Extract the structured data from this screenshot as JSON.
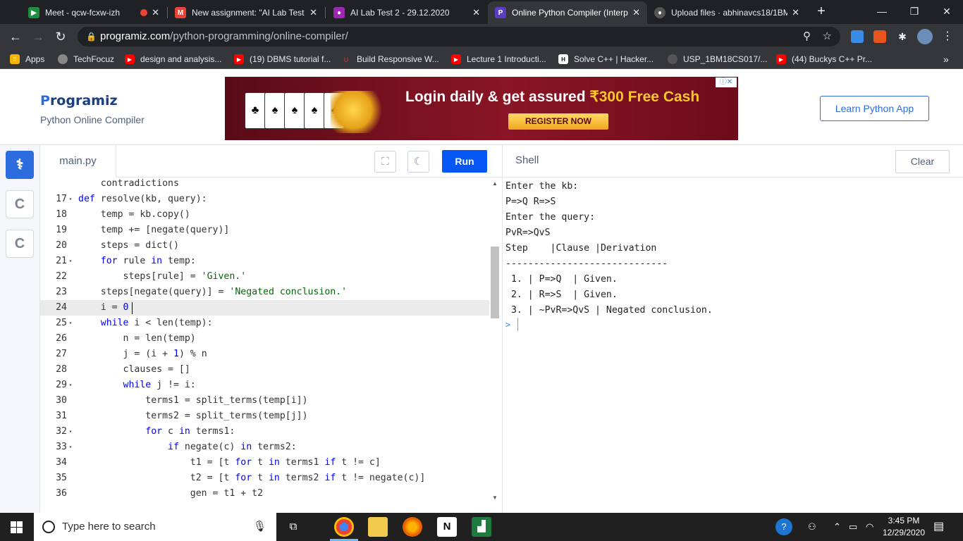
{
  "browser": {
    "tabs": [
      {
        "title": "Meet - qcw-fcxw-izh",
        "icon_color": "#1e8e3e",
        "icon": "video-icon"
      },
      {
        "title": "New assignment: \"AI Lab Test 2",
        "icon_color": "#ea4335",
        "icon": "gmail-icon"
      },
      {
        "title": "AI Lab Test 2 - 29.12.2020",
        "icon_color": "#9c27b0",
        "icon": "classroom-icon"
      },
      {
        "title": "Online Python Compiler (Interp",
        "icon_color": "#5b3cc4",
        "icon": "programiz-icon"
      },
      {
        "title": "Upload files · abhinavcs18/1BM",
        "icon_color": "#555555",
        "icon": "github-icon"
      }
    ],
    "url_host": "programiz.com",
    "url_path": "/python-programming/online-compiler/",
    "bookmarks": [
      {
        "label": "Apps",
        "color": "#f4b400"
      },
      {
        "label": "TechFocuz",
        "color": "#888888"
      },
      {
        "label": "design and analysis...",
        "color": "#ff0000"
      },
      {
        "label": "(19) DBMS tutorial f...",
        "color": "#ff0000"
      },
      {
        "label": "Build Responsive W...",
        "color": "#d32f2f"
      },
      {
        "label": "Lecture 1 Introducti...",
        "color": "#ff0000"
      },
      {
        "label": "Solve C++ | Hacker...",
        "color": "#111111"
      },
      {
        "label": "USP_1BM18CS017/...",
        "color": "#555555"
      },
      {
        "label": "(44) Buckys C++ Pr...",
        "color": "#ff0000"
      }
    ]
  },
  "site": {
    "logo": "rogramiz",
    "logo_p": "P",
    "subtitle": "Python Online Compiler",
    "learn_button": "Learn Python App",
    "ad": {
      "headline_a": "Login daily & get assured ",
      "headline_b": "₹300 Free Cash",
      "cta": "REGISTER NOW"
    }
  },
  "editor": {
    "file_tab": "main.py",
    "run_label": "Run",
    "lines": [
      {
        "n": "",
        "fold": false,
        "html": "    contradictions"
      },
      {
        "n": "17",
        "fold": true,
        "html": "<span class=\"kw\">def</span> resolve(kb, query):"
      },
      {
        "n": "18",
        "fold": false,
        "html": "    temp = kb.copy()"
      },
      {
        "n": "19",
        "fold": false,
        "html": "    temp += [negate(query)]"
      },
      {
        "n": "20",
        "fold": false,
        "html": "    steps = dict()"
      },
      {
        "n": "21",
        "fold": true,
        "html": "    <span class=\"kw\">for</span> rule <span class=\"kw\">in</span> temp:"
      },
      {
        "n": "22",
        "fold": false,
        "html": "        steps[rule] = <span class=\"st\">'Given.'</span>"
      },
      {
        "n": "23",
        "fold": false,
        "html": "    steps[negate(query)] = <span class=\"st\">'Negated conclusion.'</span>"
      },
      {
        "n": "24",
        "fold": false,
        "html": "    i = <span class=\"nm\">0</span>",
        "current": true
      },
      {
        "n": "25",
        "fold": true,
        "html": "    <span class=\"kw\">while</span> i &lt; len(temp):"
      },
      {
        "n": "26",
        "fold": false,
        "html": "        n = len(temp)"
      },
      {
        "n": "27",
        "fold": false,
        "html": "        j = (i + <span class=\"nm\">1</span>) % n"
      },
      {
        "n": "28",
        "fold": false,
        "html": "        clauses = []"
      },
      {
        "n": "29",
        "fold": true,
        "html": "        <span class=\"kw\">while</span> j != i:"
      },
      {
        "n": "30",
        "fold": false,
        "html": "            terms1 = split_terms(temp[i])"
      },
      {
        "n": "31",
        "fold": false,
        "html": "            terms2 = split_terms(temp[j])"
      },
      {
        "n": "32",
        "fold": true,
        "html": "            <span class=\"kw\">for</span> c <span class=\"kw\">in</span> terms1:"
      },
      {
        "n": "33",
        "fold": true,
        "html": "                <span class=\"kw\">if</span> negate(c) <span class=\"kw\">in</span> terms2:"
      },
      {
        "n": "34",
        "fold": false,
        "html": "                    t1 = [t <span class=\"kw\">for</span> t <span class=\"kw\">in</span> terms1 <span class=\"kw\">if</span> t != c]"
      },
      {
        "n": "35",
        "fold": false,
        "html": "                    t2 = [t <span class=\"kw\">for</span> t <span class=\"kw\">in</span> terms2 <span class=\"kw\">if</span> t != negate(c)]"
      },
      {
        "n": "36",
        "fold": false,
        "html": "                    gen = t1 + t2"
      }
    ]
  },
  "shell": {
    "title": "Shell",
    "clear_label": "Clear",
    "lines": [
      "Enter the kb:",
      "P=>Q R=>S",
      "Enter the query:",
      "PvR=>QvS",
      "Step    |Clause |Derivation",
      "-----------------------------",
      " 1. | P=>Q  | Given.",
      " 2. | R=>S  | Given.",
      " 3. | ~PvR=>QvS | Negated conclusion."
    ],
    "prompt": ">"
  },
  "taskbar": {
    "search_placeholder": "Type here to search",
    "time": "3:45 PM",
    "date": "12/29/2020"
  }
}
